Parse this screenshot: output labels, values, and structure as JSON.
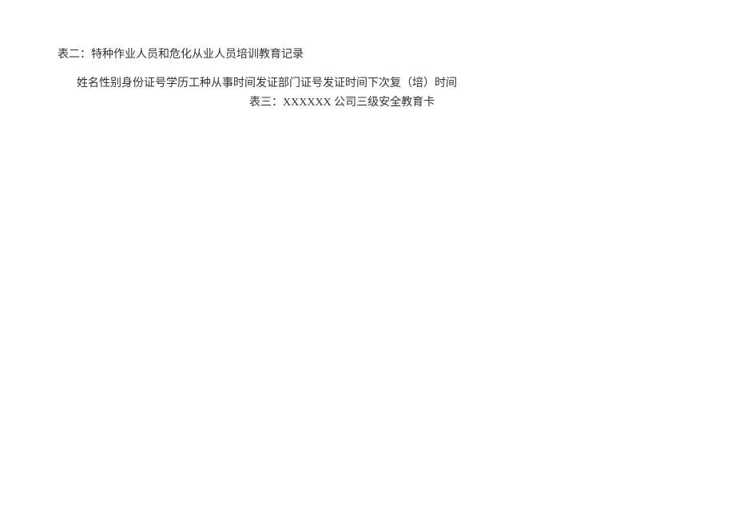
{
  "document": {
    "line1": "表二：特种作业人员和危化从业人员培训教育记录",
    "line2": "姓名性别身份证号学历工种从事时间发证部门证号发证时间下次复（培）时间",
    "line3": "表三：XXXXXX 公司三级安全教育卡"
  }
}
